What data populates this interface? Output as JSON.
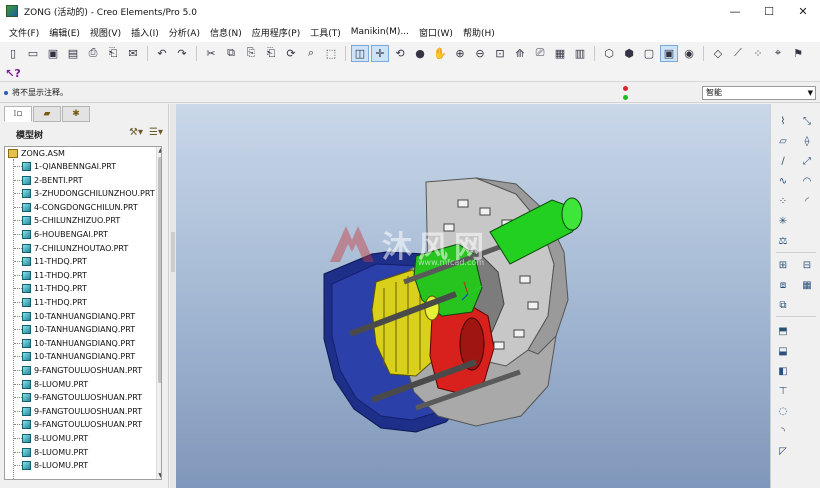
{
  "window": {
    "title": "ZONG (活动的) - Creo Elements/Pro 5.0",
    "minimize": "—",
    "maximize": "☐",
    "close": "✕"
  },
  "menu": [
    "文件(F)",
    "编辑(E)",
    "视图(V)",
    "插入(I)",
    "分析(A)",
    "信息(N)",
    "应用程序(P)",
    "工具(T)",
    "Manikin(M)...",
    "窗口(W)",
    "帮助(H)"
  ],
  "message": {
    "text": "将不显示注释。"
  },
  "filter": {
    "value": "智能"
  },
  "model_tree": {
    "title": "模型树",
    "root": "ZONG.ASM",
    "items": [
      "1-QIANBENNGAI.PRT",
      "2-BENTI.PRT",
      "3-ZHUDONGCHILUNZHOU.PRT",
      "4-CONGDONGCHILUN.PRT",
      "5-CHILUNZHIZUO.PRT",
      "6-HOUBENGAI.PRT",
      "7-CHILUNZHOUTAO.PRT",
      "11-THDQ.PRT",
      "11-THDQ.PRT",
      "11-THDQ.PRT",
      "11-THDQ.PRT",
      "10-TANHUANGDIANQ.PRT",
      "10-TANHUANGDIANQ.PRT",
      "10-TANHUANGDIANQ.PRT",
      "10-TANHUANGDIANQ.PRT",
      "9-FANGTOULUOSHUAN.PRT",
      "8-LUOMU.PRT",
      "9-FANGTOULUOSHUAN.PRT",
      "9-FANGTOULUOSHUAN.PRT",
      "9-FANGTOULUOSHUAN.PRT",
      "8-LUOMU.PRT",
      "8-LUOMU.PRT",
      "8-LUOMU.PRT"
    ]
  },
  "watermark": {
    "text": "沐风网",
    "url": "www.mfcad.com"
  },
  "colors": {
    "viewport_top": "#c9d7e8",
    "viewport_bottom": "#7f97ba",
    "housing_gray": "#b8b8b8",
    "cover_blue": "#1e2f8a",
    "shaft_green": "#22d11f",
    "gear_yellow": "#d8d01a",
    "gear_red": "#d8201c"
  }
}
